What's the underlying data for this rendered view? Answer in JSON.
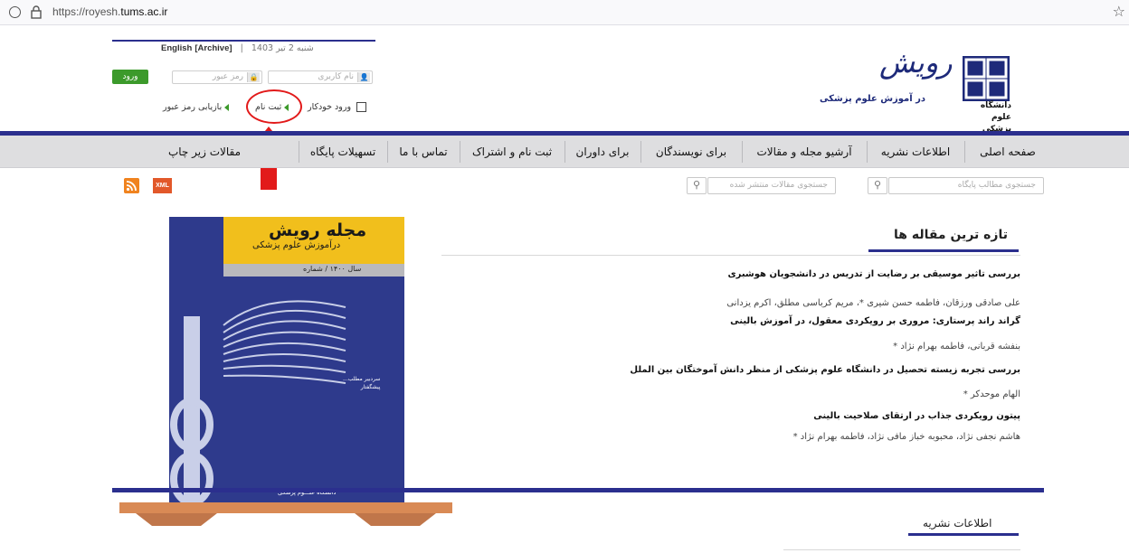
{
  "browser": {
    "url_prefix": "https://royesh.",
    "url_domain": "tums.ac.ir"
  },
  "header": {
    "date": "شنبه 2 تیر 1403",
    "archive": "[Archive]",
    "english": "English",
    "login_button": "ورود",
    "password_placeholder": "رمز عبور",
    "username_placeholder": "نام کاربری",
    "remember_me": "ورود خودکار",
    "register": "ثبت نام",
    "recover_password": "بازیابی رمز عبور",
    "journal_logo_text": "رویش",
    "journal_subtitle": "در آموزش علوم پزشکی",
    "university_name_line1": "دانشگاه علوم",
    "university_name_line2": "پزشکی تهران"
  },
  "nav": {
    "items": [
      "صفحه اصلی",
      "اطلاعات نشریه",
      "آرشیو مجله و مقالات",
      "برای نویسندگان",
      "برای داوران",
      "ثبت نام و اشتراک",
      "تماس با ما",
      "تسهیلات پایگاه",
      "مقالات زیر چاپ"
    ]
  },
  "search": {
    "site_placeholder": "جستجوی مطالب پایگاه",
    "articles_placeholder": "جستجوی مقالات منتشر شده",
    "xml_label": "XML"
  },
  "cover": {
    "title": "مجله رویش",
    "subtitle": "درآموزش علوم پزشکی",
    "year_line": "سال ۱۴۰۰ / شماره",
    "side_line1": "سردبیر مطلب...",
    "side_line2": "پیشگفتار",
    "bottom_text": "دانشگاه علـــوم پزشکی"
  },
  "latest": {
    "title": "تازه ترین مقاله ها",
    "articles": [
      {
        "title": "بررسی تاثیر موسیقی بر رضایت از تدریس در دانشجویان هوشبری",
        "authors": "علی صادقی ورزقان، فاطمه حسن شیری *، مریم کرباسی مطلق، اکرم یزدانی"
      },
      {
        "title": "گراند راند پرستاری: مروری بر رویکردی معقول، در آموزش بالینی",
        "authors": "بنفشه قربانی، فاطمه بهرام نژاد *"
      },
      {
        "title": "بررسی تجربه زیسته تحصیل در دانشگاه علوم پزشکی از منظر دانش آموختگان بین الملل",
        "authors": "الهام موحدکر *"
      },
      {
        "title": "پیتون رویکردی جذاب در ارتقای صلاحیت بالینی",
        "authors": "هاشم نجفی نژاد، محبوبه خباز مافی نژاد، فاطمه بهرام نژاد *"
      }
    ]
  },
  "info": {
    "title": "اطلاعات نشریه"
  },
  "colors": {
    "brand_blue": "#2b2f8e",
    "login_green": "#3c9a2b",
    "annotation_red": "#e21a1a",
    "rss_orange": "#f0831f"
  }
}
